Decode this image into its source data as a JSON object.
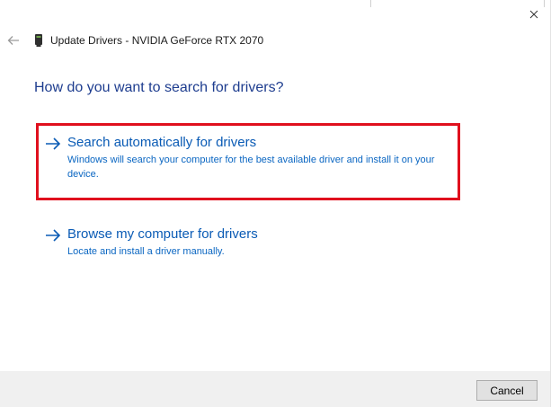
{
  "window": {
    "title": "Update Drivers - NVIDIA GeForce RTX 2070"
  },
  "icons": {
    "back": "back-arrow-icon",
    "close": "close-icon",
    "device": "graphics-card-icon",
    "option_arrow": "right-arrow-icon"
  },
  "heading": "How do you want to search for drivers?",
  "options": [
    {
      "title": "Search automatically for drivers",
      "description": "Windows will search your computer for the best available driver and install it on your device.",
      "highlighted": true
    },
    {
      "title": "Browse my computer for drivers",
      "description": "Locate and install a driver manually.",
      "highlighted": false
    }
  ],
  "footer": {
    "cancel_label": "Cancel"
  },
  "colors": {
    "heading": "#1e3d8f",
    "link": "#0a5bb5",
    "highlight_border": "#e0101e",
    "footer_bg": "#f0f0f0"
  }
}
